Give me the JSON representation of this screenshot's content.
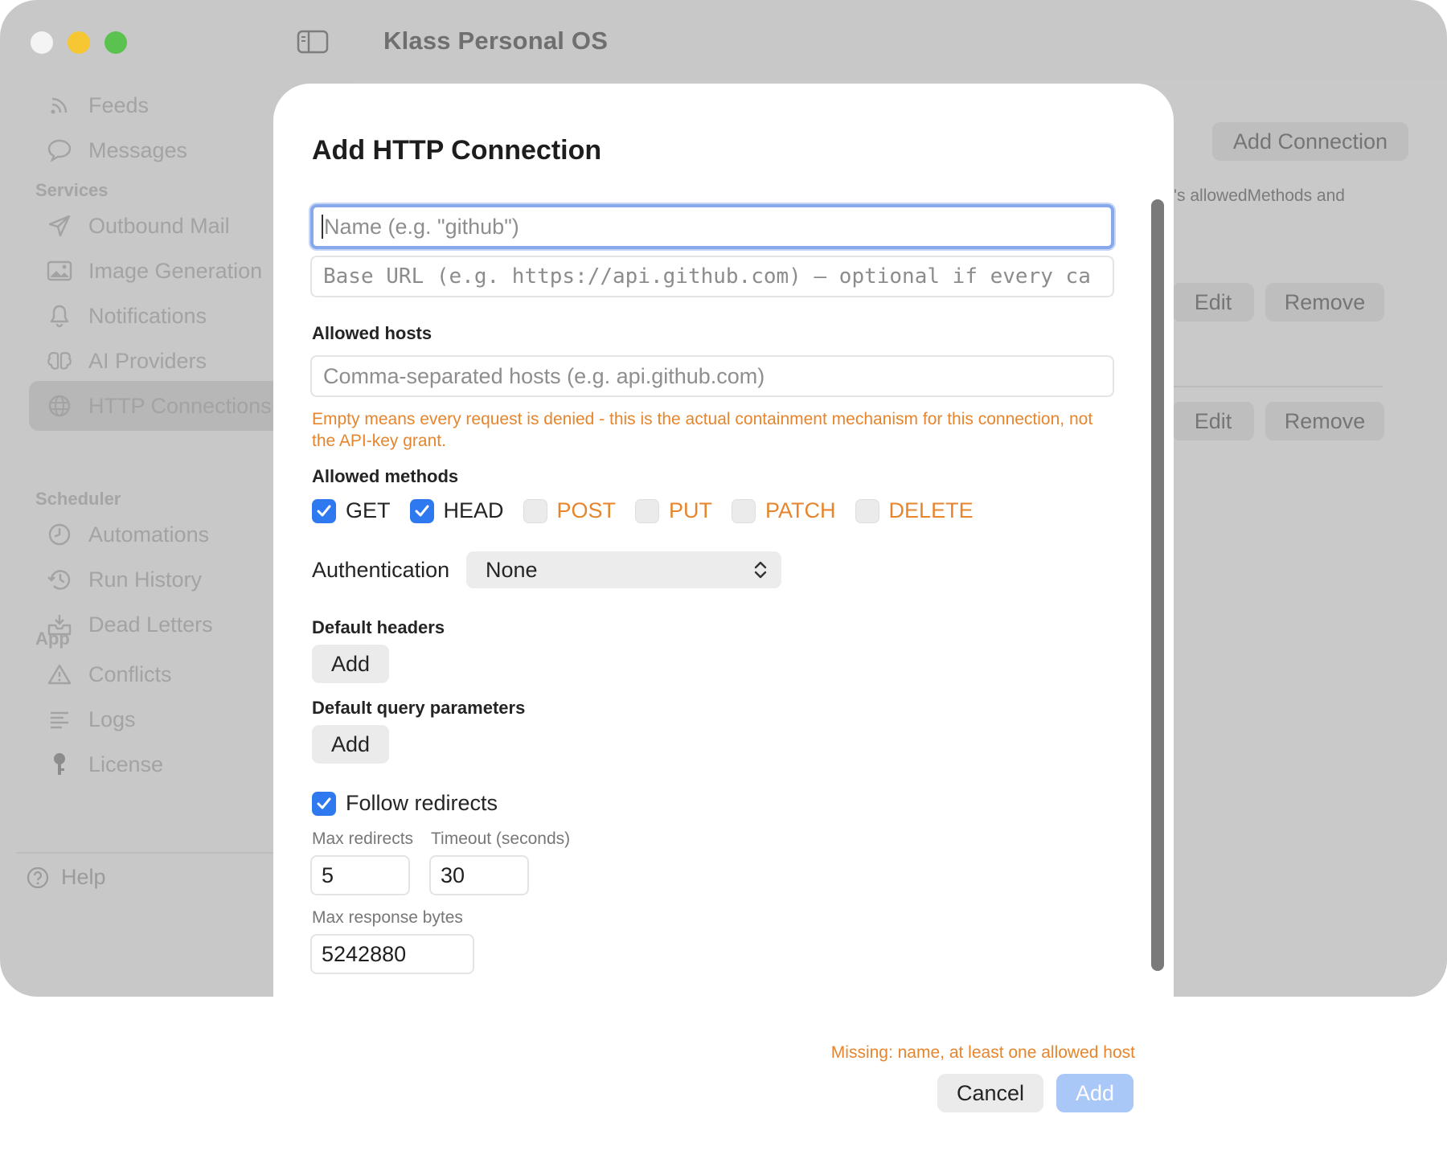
{
  "window": {
    "title": "Klass Personal OS"
  },
  "sidebar": {
    "top_items": [
      {
        "label": "Feeds",
        "icon": "rss-icon"
      },
      {
        "label": "Messages",
        "icon": "speech-bubble-icon"
      }
    ],
    "sections": [
      {
        "title": "Services",
        "items": [
          {
            "label": "Outbound Mail",
            "icon": "paper-plane-icon"
          },
          {
            "label": "Image Generation",
            "icon": "image-icon"
          },
          {
            "label": "Notifications",
            "icon": "bell-icon"
          },
          {
            "label": "AI Providers",
            "icon": "brain-icon"
          },
          {
            "label": "HTTP Connections",
            "icon": "globe-icon",
            "active": true
          }
        ]
      },
      {
        "title": "Scheduler",
        "items": [
          {
            "label": "Automations",
            "icon": "clock-icon"
          },
          {
            "label": "Run History",
            "icon": "history-icon"
          },
          {
            "label": "Dead Letters",
            "icon": "inbox-tray-icon"
          }
        ]
      },
      {
        "title": "App",
        "items": [
          {
            "label": "Conflicts",
            "icon": "warning-triangle-icon"
          },
          {
            "label": "Logs",
            "icon": "text-lines-icon"
          },
          {
            "label": "License",
            "icon": "key-icon"
          }
        ]
      }
    ],
    "help_label": "Help"
  },
  "background": {
    "add_connection_label": "Add Connection",
    "description_fragment": "'s allowedMethods and",
    "rows": [
      {
        "edit_label": "Edit",
        "remove_label": "Remove"
      },
      {
        "edit_label": "Edit",
        "remove_label": "Remove"
      }
    ]
  },
  "dialog": {
    "title": "Add HTTP Connection",
    "name_placeholder": "Name (e.g. \"github\")",
    "base_url_placeholder": "Base URL (e.g. https://api.github.com) – optional if every ca",
    "allowed_hosts_label": "Allowed hosts",
    "allowed_hosts_placeholder": "Comma-separated hosts (e.g. api.github.com)",
    "allowed_hosts_warning": "Empty means every request is denied - this is the actual containment mechanism for this connection, not the API-key grant.",
    "allowed_methods_label": "Allowed methods",
    "methods": [
      {
        "label": "GET",
        "checked": true
      },
      {
        "label": "HEAD",
        "checked": true
      },
      {
        "label": "POST",
        "checked": false
      },
      {
        "label": "PUT",
        "checked": false
      },
      {
        "label": "PATCH",
        "checked": false
      },
      {
        "label": "DELETE",
        "checked": false
      }
    ],
    "authentication_label": "Authentication",
    "authentication_value": "None",
    "default_headers_label": "Default headers",
    "default_headers_add": "Add",
    "default_query_label": "Default query parameters",
    "default_query_add": "Add",
    "follow_redirects_label": "Follow redirects",
    "follow_redirects_checked": true,
    "max_redirects_label": "Max redirects",
    "max_redirects_value": "5",
    "timeout_label": "Timeout (seconds)",
    "timeout_value": "30",
    "max_response_label": "Max response bytes",
    "max_response_value": "5242880",
    "missing_message": "Missing: name, at least one allowed host",
    "cancel_label": "Cancel",
    "confirm_label": "Add"
  },
  "colors": {
    "accent": "#2f79f0",
    "warning": "#e6852d",
    "disabled_primary": "#a9c7f7"
  }
}
